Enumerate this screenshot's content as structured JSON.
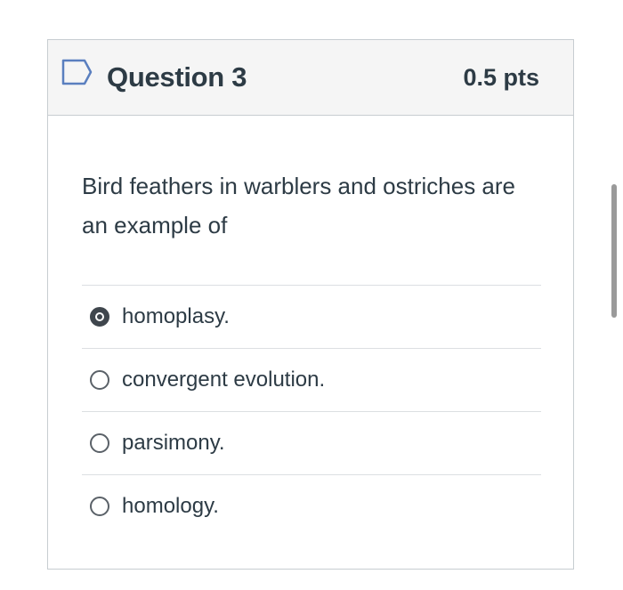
{
  "question": {
    "title": "Question 3",
    "points": "0.5 pts",
    "flag_icon": "flag-outline-icon",
    "text": "Bird feathers in warblers and ostriches are an example of"
  },
  "answers": [
    {
      "label": "homoplasy.",
      "selected": true
    },
    {
      "label": "convergent evolution.",
      "selected": false
    },
    {
      "label": "parsimony.",
      "selected": false
    },
    {
      "label": "homology.",
      "selected": false
    }
  ],
  "colors": {
    "text": "#2d3b45",
    "header_bg": "#f5f5f5",
    "border": "#c7cdd1",
    "flag": "#5a7fbf"
  }
}
